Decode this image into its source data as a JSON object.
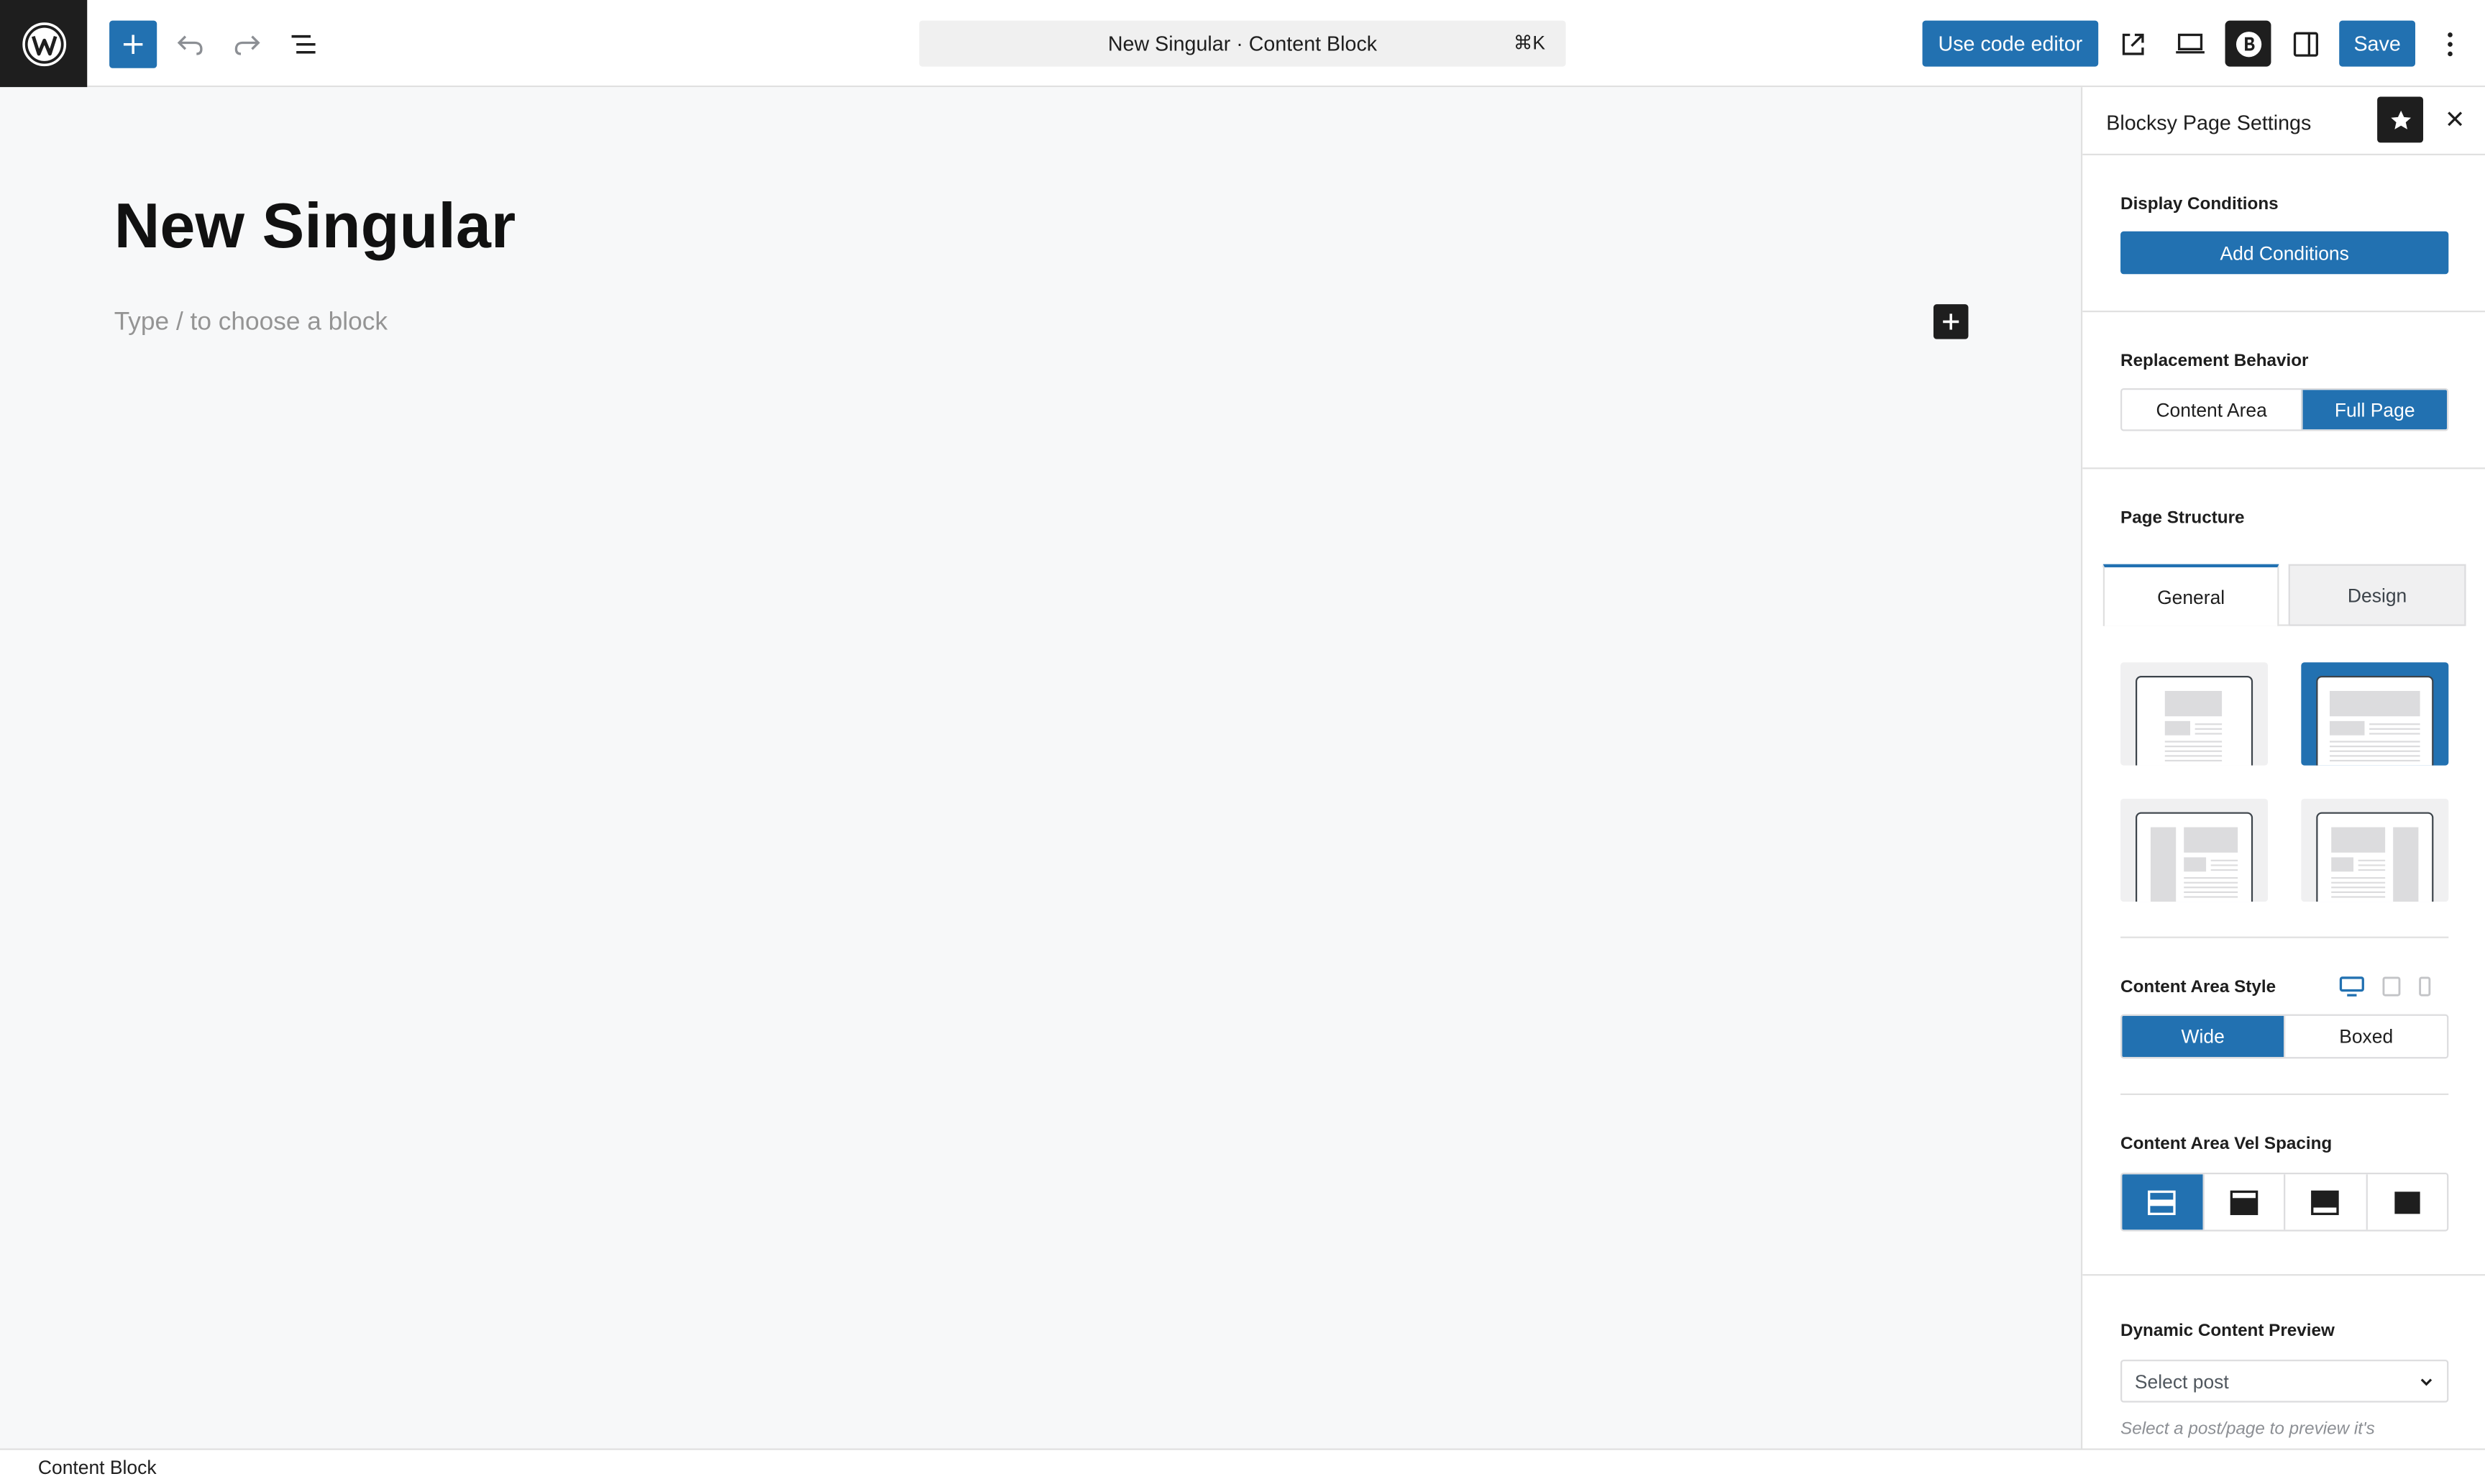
{
  "toolbar": {
    "document_title": "New Singular · Content Block",
    "shortcut": "⌘K",
    "code_editor_label": "Use code editor",
    "save_label": "Save"
  },
  "editor": {
    "post_title": "New Singular",
    "block_placeholder": "Type / to choose a block"
  },
  "sidebar": {
    "title": "Blocksy Page Settings",
    "display_conditions": {
      "label": "Display Conditions",
      "button": "Add Conditions"
    },
    "replacement_behavior": {
      "label": "Replacement Behavior",
      "options": [
        "Content Area",
        "Full Page"
      ],
      "selected": "Full Page"
    },
    "page_structure": {
      "label": "Page Structure",
      "tabs": [
        "General",
        "Design"
      ],
      "active_tab": "General",
      "layouts": [
        "layout-option-1",
        "layout-option-2",
        "layout-option-3",
        "layout-option-4"
      ],
      "selected_layout": "layout-option-2"
    },
    "content_area_style": {
      "label": "Content Area Style",
      "options": [
        "Wide",
        "Boxed"
      ],
      "selected": "Wide",
      "active_device": "desktop"
    },
    "vertical_spacing": {
      "label": "Content Area Vel Spacing",
      "selected_index": 0
    },
    "dynamic_preview": {
      "label": "Dynamic Content Preview",
      "placeholder": "Select post",
      "help": "Select a post/page to preview it's"
    }
  },
  "footer": {
    "breadcrumb": "Content Block"
  },
  "colors": {
    "accent": "#2271b1",
    "dark": "#1e1e1e",
    "canvas": "#f7f8f9"
  }
}
